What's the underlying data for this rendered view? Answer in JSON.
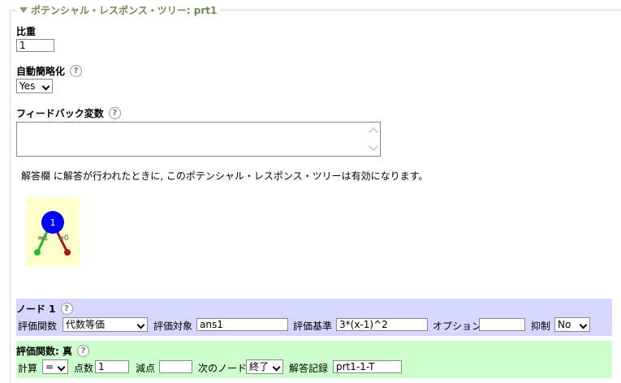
{
  "prt": {
    "legend": "ポテンシャル・レスポンス・ツリー: prt1",
    "weight_label": "比重",
    "weight_value": "1",
    "autosimplify_label": "自動簡略化",
    "autosimplify_value": "Yes",
    "feedbackvars_label": "フィードバック変数",
    "feedbackvars_value": "",
    "status_text": "解答欄 に解答が行われたときに, このポテンシャル・レスポンス・ツリーは有効になります。"
  },
  "tree": {
    "node_label": "1",
    "true_label": "=1",
    "false_label": "=0",
    "colors": {
      "node": "#0000ff",
      "true_edge": "#22bb22",
      "false_edge": "#aa1111",
      "background": "#ffffcc"
    }
  },
  "node": {
    "title": "ノード 1",
    "answertest_label": "評価関数",
    "answertest_value": "代数等価",
    "sans_label": "評価対象",
    "sans_value": "ans1",
    "tans_label": "評価基準",
    "tans_value": "3*(x-1)^2",
    "options_label": "オプション",
    "options_value": "",
    "quiet_label": "抑制",
    "quiet_value": "No"
  },
  "true_branch": {
    "title": "評価関数: 真",
    "score_mode_label": "計算",
    "score_mode_value": "=",
    "score_label": "点数",
    "score_value": "1",
    "penalty_label": "減点",
    "penalty_value": "",
    "next_label": "次のノード",
    "next_value": "終了",
    "answernote_label": "解答記録",
    "answernote_value": "prt1-1-T"
  },
  "icons": {
    "help": "help-icon",
    "collapse": "collapse-triangle-icon"
  }
}
